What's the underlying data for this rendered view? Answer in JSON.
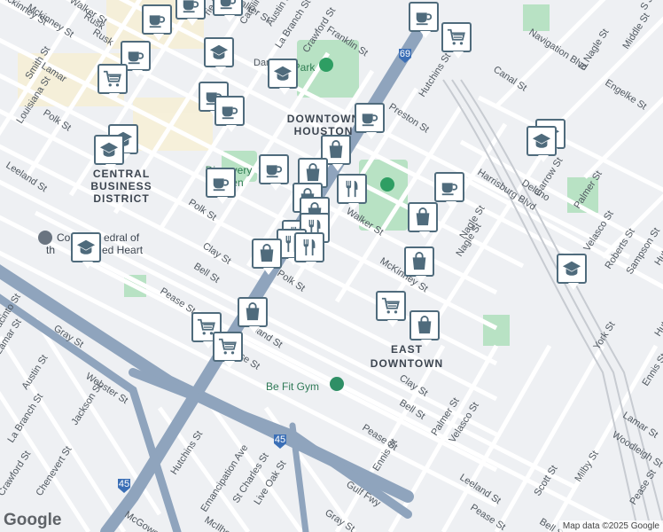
{
  "map": {
    "places": [
      "DOWNTOWN",
      "HOUSTON",
      "CENTRAL",
      "BUSINESS",
      "DISTRICT",
      "EAST",
      "DOWNTOWN"
    ],
    "pois": {
      "discovery": [
        "Discovery",
        "Green"
      ],
      "park": "Da   Park",
      "gym": "Be Fit Gym",
      "cathedral": [
        "Co",
        "edral of",
        "th",
        "ed Heart"
      ]
    },
    "streets": [
      "Mckinney St",
      "Walker St",
      "Rusk",
      "Lamar",
      "Smith St",
      "Louisiana St",
      "Polk St",
      "Leeland St",
      "Bell St",
      "Clay St",
      "Pease St",
      "La Branch St",
      "Crawford St",
      "Franklin St",
      "Caroline",
      "Austin St",
      "Hutchins St",
      "Preston St",
      "Navigation Blvd",
      "Canal St",
      "N Nagle St",
      "Engelke St",
      "Middle St",
      "Harrisburg Blvd",
      "Delano",
      "Garrow St",
      "Palmer St",
      "Nagle St",
      "Velasco St",
      "Roberts St",
      "Sampson St",
      "York St",
      "Gray St",
      "Webster St",
      "Jackson St",
      "Chenevert St",
      "McGowen St",
      "Emancipation Ave",
      "St Charles St",
      "Live Oak St",
      "Gulf Fwy",
      "Ennis St",
      "Scott St",
      "Milby St",
      "Lamar St",
      "Woodleigh St",
      "Hutch",
      "Hutc",
      "acinto St",
      "Pease St",
      "Clay St",
      "Bell St",
      "Leeland St",
      "Polk St",
      "Palmer St",
      "Velasco St",
      "Pease St",
      "Ennis St",
      "Hutchins St",
      "McIlhe",
      "Gray St",
      "Bell St",
      "Pease St",
      "Polk St",
      "land St",
      "ase St",
      "McKinney St",
      "Walker St",
      "S Je",
      "Walker St",
      "Rusk",
      "rie St",
      "La Branch St",
      "Austin St",
      "Lamar St",
      "Mckinney St",
      "Dan",
      "Nagle St",
      "Crawford St"
    ],
    "highways": [
      "45",
      "69",
      "45"
    ]
  },
  "attribution": {
    "logo": "Google",
    "credit": "Map data ©2025 Google"
  },
  "icons": {
    "education": "graduation-cap-icon",
    "cafe": "coffee-cup-icon",
    "grocery": "shopping-cart-icon",
    "shopping": "shopping-bag-icon",
    "restaurant": "fork-knife-icon"
  },
  "colors": {
    "marker_border": "#4f6b7c",
    "highway": "#8fa4bd",
    "park": "#b8e2c4"
  }
}
